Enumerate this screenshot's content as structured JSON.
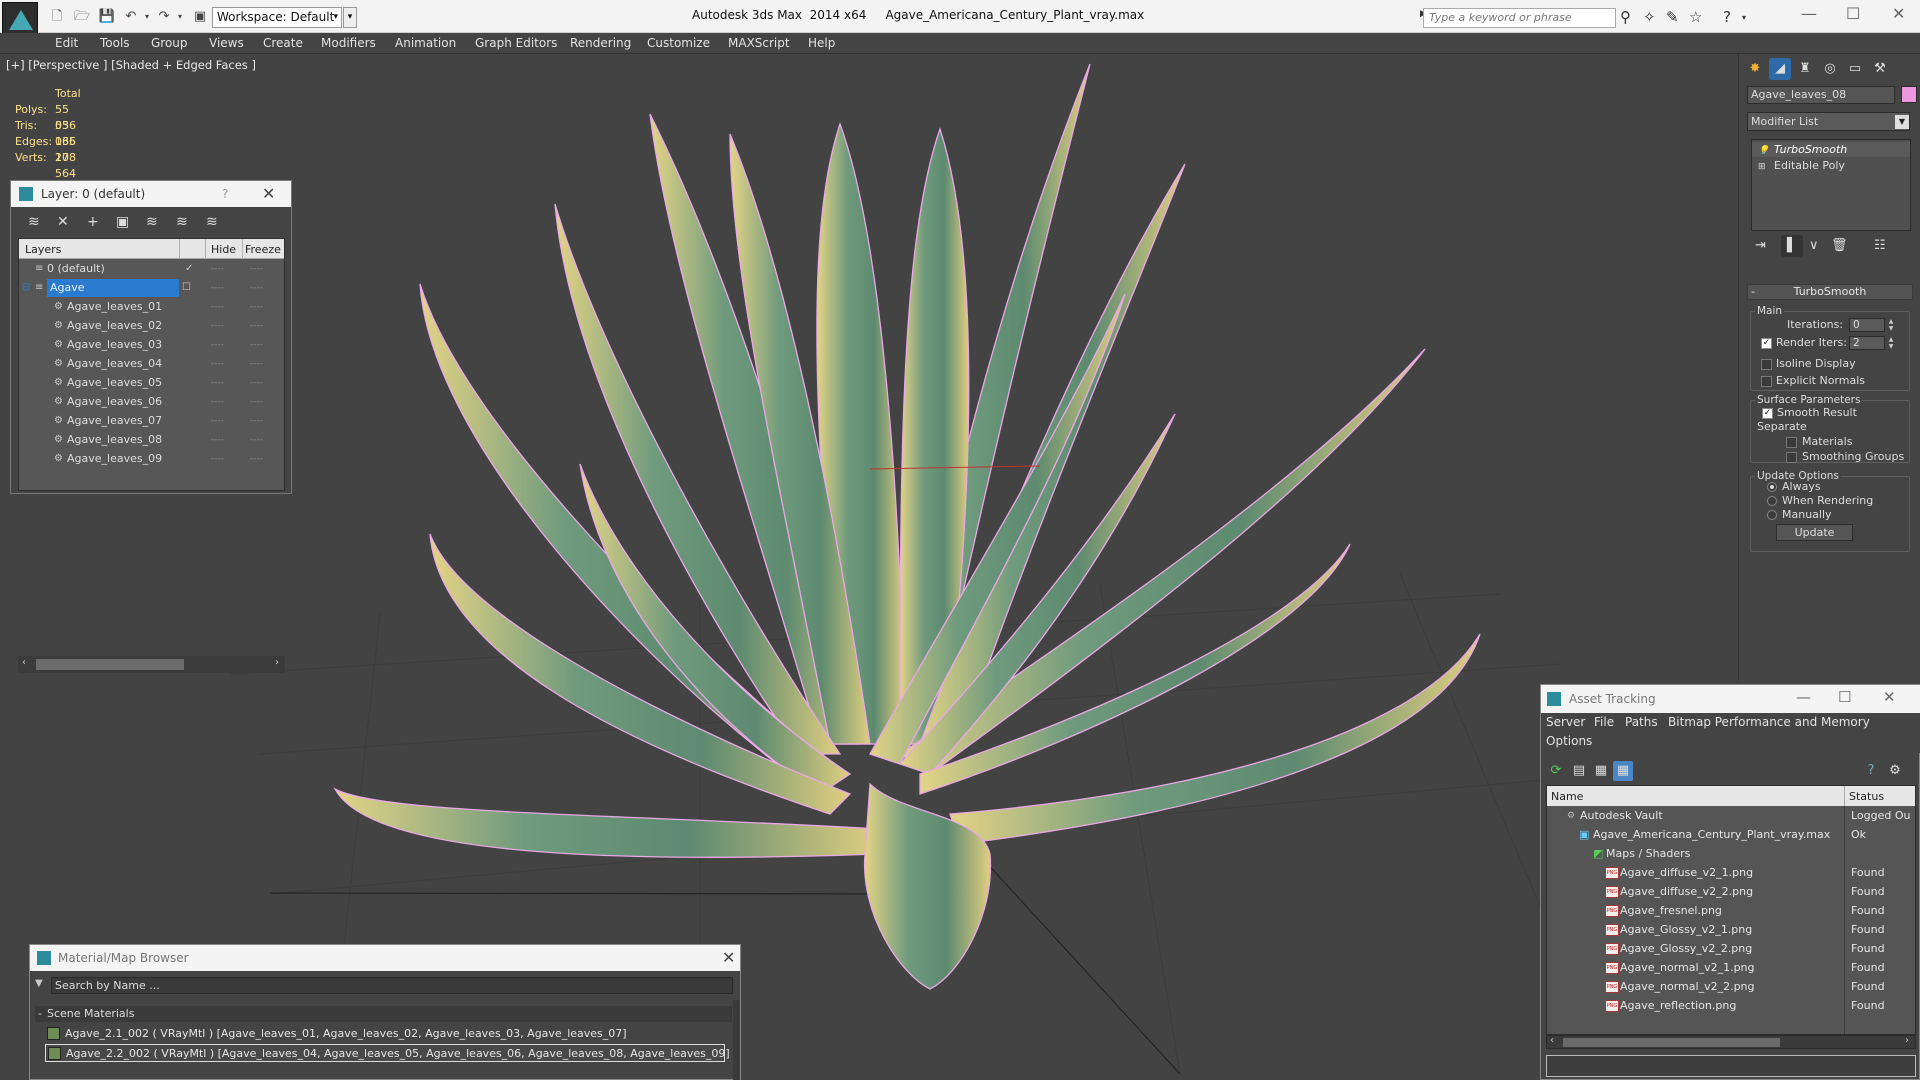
{
  "titlebar": {
    "app_title": "Autodesk 3ds Max  2014 x64",
    "file_name": "Agave_Americana_Century_Plant_vray.max",
    "workspace": "Workspace: Default",
    "search_placeholder": "Type a keyword or phrase"
  },
  "menu": [
    "Edit",
    "Tools",
    "Group",
    "Views",
    "Create",
    "Modifiers",
    "Animation",
    "Graph Editors",
    "Rendering",
    "Customize",
    "MAXScript",
    "Help"
  ],
  "viewport": {
    "label": "[+] [Perspective ] [Shaded + Edged Faces ]",
    "stats": {
      "total_label": "Total",
      "polys_label": "Polys:",
      "polys": "55 036",
      "tris_label": "Tris:",
      "tris": "55 036",
      "edges_label": "Edges:",
      "edges": "165 108",
      "verts_label": "Verts:",
      "verts": "27 564"
    }
  },
  "layer_window": {
    "title": "Layer: 0 (default)",
    "help": "?",
    "columns": {
      "layers": "Layers",
      "hide": "Hide",
      "freeze": "Freeze"
    },
    "rows": [
      {
        "name": "0 (default)"
      },
      {
        "name": "Agave"
      },
      {
        "name": "Agave_leaves_01"
      },
      {
        "name": "Agave_leaves_02"
      },
      {
        "name": "Agave_leaves_03"
      },
      {
        "name": "Agave_leaves_04"
      },
      {
        "name": "Agave_leaves_05"
      },
      {
        "name": "Agave_leaves_06"
      },
      {
        "name": "Agave_leaves_07"
      },
      {
        "name": "Agave_leaves_08"
      },
      {
        "name": "Agave_leaves_09"
      }
    ],
    "dash": "----"
  },
  "command_panel": {
    "object_name": "Agave_leaves_08",
    "object_color": "#ec97de",
    "modifier_list": "Modifier List",
    "stack": [
      "TurboSmooth",
      "Editable Poly"
    ],
    "turbosmooth": {
      "header": "TurboSmooth",
      "main_label": "Main",
      "iterations_label": "Iterations:",
      "iterations": "0",
      "render_iters_label": "Render Iters:",
      "render_iters": "2",
      "isoline_label": "Isoline Display",
      "explicit_normals_label": "Explicit Normals",
      "surface_label": "Surface Parameters",
      "smooth_result_label": "Smooth Result",
      "separate_label": "Separate",
      "materials_label": "Materials",
      "smoothing_groups_label": "Smoothing Groups",
      "update_options_label": "Update Options",
      "always_label": "Always",
      "when_rendering_label": "When Rendering",
      "manually_label": "Manually",
      "update_button": "Update"
    }
  },
  "material_browser": {
    "title": "Material/Map Browser",
    "search_placeholder": "Search by Name ...",
    "section": "Scene Materials",
    "rows": [
      "Agave_2.1_002  ( VRayMtl )  [Agave_leaves_01, Agave_leaves_02, Agave_leaves_03, Agave_leaves_07]",
      "Agave_2.2_002  ( VRayMtl )  [Agave_leaves_04, Agave_leaves_05, Agave_leaves_06, Agave_leaves_08, Agave_leaves_09]"
    ]
  },
  "asset_tracking": {
    "title": "Asset Tracking",
    "menu": [
      "Server",
      "File",
      "Paths",
      "Bitmap Performance and Memory",
      "Options"
    ],
    "columns": {
      "name": "Name",
      "status": "Status"
    },
    "rows": [
      {
        "name": "Autodesk Vault",
        "status": "Logged Ou"
      },
      {
        "name": "Agave_Americana_Century_Plant_vray.max",
        "status": "Ok"
      },
      {
        "name": "Maps / Shaders",
        "status": ""
      },
      {
        "name": "Agave_diffuse_v2_1.png",
        "status": "Found"
      },
      {
        "name": "Agave_diffuse_v2_2.png",
        "status": "Found"
      },
      {
        "name": "Agave_fresnel.png",
        "status": "Found"
      },
      {
        "name": "Agave_Glossy_v2_1.png",
        "status": "Found"
      },
      {
        "name": "Agave_Glossy_v2_2.png",
        "status": "Found"
      },
      {
        "name": "Agave_normal_v2_1.png",
        "status": "Found"
      },
      {
        "name": "Agave_normal_v2_2.png",
        "status": "Found"
      },
      {
        "name": "Agave_reflection.png",
        "status": "Found"
      }
    ]
  }
}
